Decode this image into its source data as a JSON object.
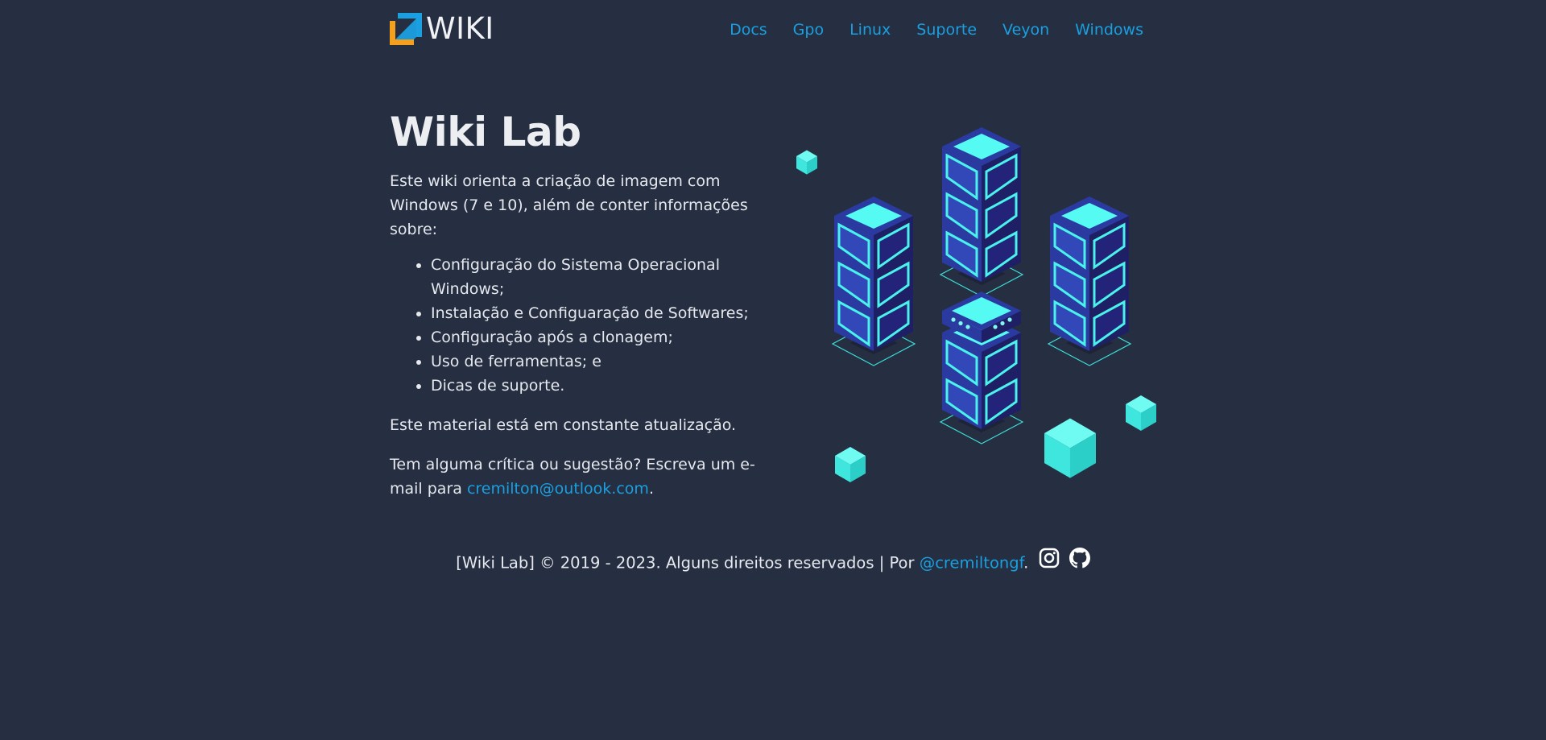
{
  "header": {
    "logo_text": "WIKI",
    "nav": [
      "Docs",
      "Gpo",
      "Linux",
      "Suporte",
      "Veyon",
      "Windows"
    ]
  },
  "main": {
    "title": "Wiki Lab",
    "intro": "Este wiki orienta a criação de imagem com Windows (7 e 10), além de conter informações sobre:",
    "list": [
      "Configuração do Sistema Operacional Windows;",
      "Instalação e Configuaração de Softwares;",
      "Configuração após a clonagem;",
      "Uso de ferramentas; e",
      "Dicas de suporte."
    ],
    "update_note": "Este material está em constante atualização.",
    "contact_prefix": "Tem alguma crítica ou sugestão? Escreva um e-mail para ",
    "contact_email": "cremilton@outlook.com",
    "contact_suffix": "."
  },
  "footer": {
    "text": "[Wiki Lab] © 2019 - 2023. Alguns direitos reservados | Por ",
    "handle": "@cremiltongf",
    "suffix": ".",
    "icons": [
      "instagram-icon",
      "github-icon"
    ]
  },
  "colors": {
    "background": "#252f41",
    "link": "#1a9fe0",
    "logo_blue": "#1a9fe0",
    "logo_orange": "#f4a01d",
    "cyan": "#3ef0e8",
    "server_dark": "#1f1f66"
  }
}
